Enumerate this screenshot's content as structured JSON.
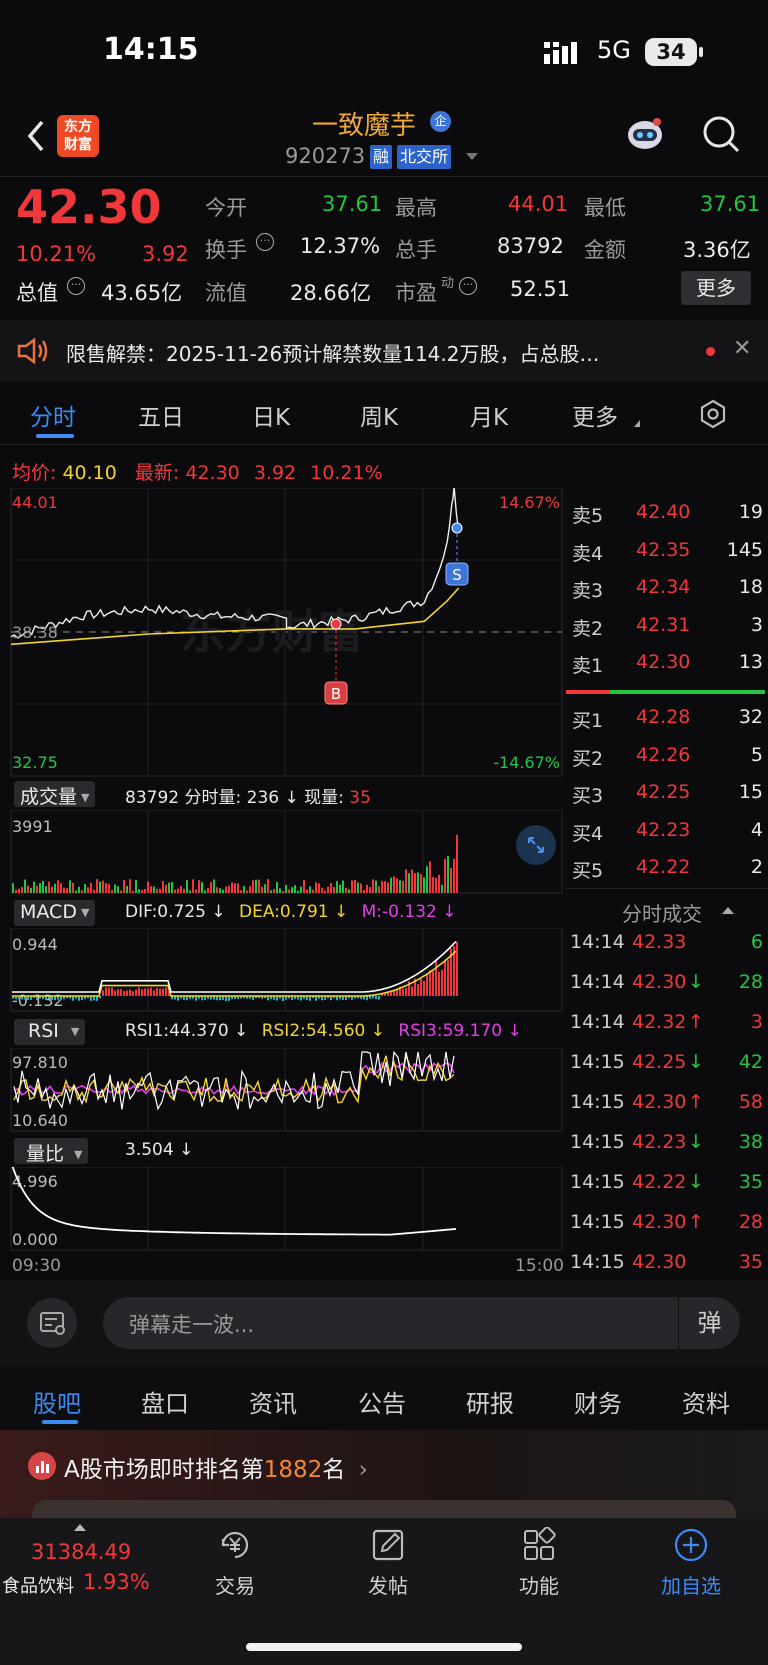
{
  "status_bar": {
    "time": "14:15",
    "network": "5G",
    "battery": "34"
  },
  "header": {
    "logo_line1": "东方",
    "logo_line2": "财富",
    "stock_name": "一致魔芋",
    "badge_enterprise": "企",
    "code": "920273",
    "tag_margin": "融",
    "tag_exchange": "北交所"
  },
  "quote": {
    "price": "42.30",
    "change_pct": "10.21%",
    "change": "3.92",
    "open_label": "今开",
    "open": "37.61",
    "high_label": "最高",
    "high": "44.01",
    "low_label": "最低",
    "low": "37.61",
    "turnover_label": "换手",
    "turnover": "12.37%",
    "volume_label": "总手",
    "volume": "83792",
    "amount_label": "金额",
    "amount": "3.36亿",
    "mktcap_label": "总值",
    "mktcap": "43.65亿",
    "float_label": "流值",
    "float_cap": "28.66亿",
    "pe_label": "市盈",
    "pe_sup": "动",
    "pe": "52.51",
    "more_button": "更多"
  },
  "notice": {
    "text": "限售解禁：2025-11-26预计解禁数量114.2万股，占总股…"
  },
  "period_tabs": [
    "分时",
    "五日",
    "日K",
    "周K",
    "月K",
    "更多"
  ],
  "chart_header": {
    "avg_label": "均价:",
    "avg_value": "40.10",
    "latest_label": "最新:",
    "latest_value": "42.30",
    "latest_change": "3.92",
    "latest_pct": "10.21%"
  },
  "chart_labels": {
    "y_high": "44.01",
    "y_low": "32.75",
    "y_mid": "38.38",
    "pct_high": "14.67%",
    "pct_low": "-14.67%",
    "buy_marker": "B",
    "sell_marker": "S",
    "watermark": "东方财富",
    "time_start": "09:30",
    "time_end": "15:00"
  },
  "chart_data": {
    "type": "line",
    "x_range": [
      "09:30",
      "15:00"
    ],
    "ylim": [
      32.75,
      44.01
    ],
    "prev_close": 38.38,
    "series": [
      {
        "name": "最新",
        "points_time": [
          "09:30",
          "09:45",
          "10:00",
          "10:30",
          "11:00",
          "11:30",
          "13:00",
          "13:30",
          "14:00",
          "14:05",
          "14:10",
          "14:12",
          "14:13",
          "14:15"
        ],
        "values": [
          38.2,
          38.6,
          39.0,
          39.3,
          39.0,
          38.9,
          38.6,
          38.9,
          39.6,
          40.5,
          41.8,
          43.5,
          44.01,
          42.3
        ]
      },
      {
        "name": "均价",
        "points_time": [
          "09:30",
          "10:30",
          "11:30",
          "13:30",
          "14:00",
          "14:10",
          "14:15"
        ],
        "values": [
          37.9,
          38.3,
          38.5,
          38.5,
          38.8,
          39.6,
          40.1
        ]
      }
    ]
  },
  "volume_panel": {
    "label": "成交量",
    "total": "83792",
    "minute_label": "分时量:",
    "minute_value": "236",
    "arrow": "↓",
    "current_label": "现量:",
    "current_value": "35",
    "y_max": "3991"
  },
  "macd_panel": {
    "label": "MACD",
    "dif": "DIF:0.725 ↓",
    "dea": "DEA:0.791 ↓",
    "m": "M:-0.132 ↓",
    "y_max": "0.944",
    "y_min": "-0.132"
  },
  "rsi_panel": {
    "label": "RSI",
    "rsi1": "RSI1:44.370 ↓",
    "rsi2": "RSI2:54.560 ↓",
    "rsi3": "RSI3:59.170 ↓",
    "y_max": "97.810",
    "y_min": "10.640"
  },
  "ratio_panel": {
    "label": "量比",
    "value": "3.504 ↓",
    "y_max": "4.996",
    "y_min": "0.000"
  },
  "order_book": {
    "asks": [
      {
        "label": "卖5",
        "price": "42.40",
        "qty": "19"
      },
      {
        "label": "卖4",
        "price": "42.35",
        "qty": "145"
      },
      {
        "label": "卖3",
        "price": "42.34",
        "qty": "18"
      },
      {
        "label": "卖2",
        "price": "42.31",
        "qty": "3"
      },
      {
        "label": "卖1",
        "price": "42.30",
        "qty": "13"
      }
    ],
    "bids": [
      {
        "label": "买1",
        "price": "42.28",
        "qty": "32"
      },
      {
        "label": "买2",
        "price": "42.26",
        "qty": "5"
      },
      {
        "label": "买3",
        "price": "42.25",
        "qty": "15"
      },
      {
        "label": "买4",
        "price": "42.23",
        "qty": "4"
      },
      {
        "label": "买5",
        "price": "42.22",
        "qty": "2"
      }
    ]
  },
  "trades": {
    "title": "分时成交",
    "rows": [
      {
        "time": "14:14",
        "price": "42.33",
        "dir": "",
        "qty": "6",
        "qty_color": "green"
      },
      {
        "time": "14:14",
        "price": "42.30",
        "dir": "↓",
        "qty": "28",
        "qty_color": "green"
      },
      {
        "time": "14:14",
        "price": "42.32",
        "dir": "↑",
        "qty": "3",
        "qty_color": "red"
      },
      {
        "time": "14:15",
        "price": "42.25",
        "dir": "↓",
        "qty": "42",
        "qty_color": "green"
      },
      {
        "time": "14:15",
        "price": "42.30",
        "dir": "↑",
        "qty": "58",
        "qty_color": "red"
      },
      {
        "time": "14:15",
        "price": "42.23",
        "dir": "↓",
        "qty": "38",
        "qty_color": "green"
      },
      {
        "time": "14:15",
        "price": "42.22",
        "dir": "↓",
        "qty": "35",
        "qty_color": "green"
      },
      {
        "time": "14:15",
        "price": "42.30",
        "dir": "↑",
        "qty": "28",
        "qty_color": "red"
      },
      {
        "time": "14:15",
        "price": "42.30",
        "dir": "",
        "qty": "35",
        "qty_color": "red"
      }
    ]
  },
  "danmaku": {
    "placeholder": "弹幕走一波...",
    "send": "弹"
  },
  "section_tabs": [
    "股吧",
    "盘口",
    "资讯",
    "公告",
    "研报",
    "财务",
    "资料"
  ],
  "ranking": {
    "prefix": "A股市场即时排名第",
    "rank": "1882",
    "suffix": "名"
  },
  "bottom_nav": {
    "index_value": "31384.49",
    "index_name": "食品饮料",
    "index_pct": "1.93%",
    "items": [
      "交易",
      "发帖",
      "功能",
      "加自选"
    ]
  },
  "colors": {
    "up": "#f0383b",
    "down": "#24c542",
    "accent": "#3d8bf2",
    "avg_line": "#f2d42e"
  }
}
